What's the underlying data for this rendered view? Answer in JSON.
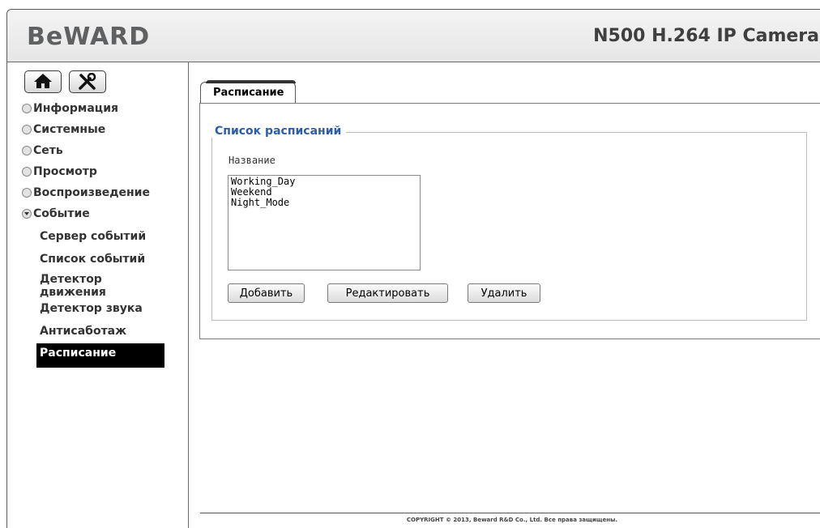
{
  "header": {
    "logo": "BeWARD",
    "product": "N500 H.264 IP Camera"
  },
  "toolbar": {
    "home_icon": "home-icon",
    "tools_icon": "tools-icon"
  },
  "sidebar": {
    "items": [
      {
        "label": "Информация",
        "expanded": false
      },
      {
        "label": "Системные",
        "expanded": false
      },
      {
        "label": "Сеть",
        "expanded": false
      },
      {
        "label": "Просмотр",
        "expanded": false
      },
      {
        "label": "Воспроизведение",
        "expanded": false
      },
      {
        "label": "Событие",
        "expanded": true
      }
    ],
    "subitems": [
      {
        "label": "Сервер событий"
      },
      {
        "label": "Список событий"
      },
      {
        "label": "Детектор движения"
      },
      {
        "label": "Детектор звука"
      },
      {
        "label": "Антисаботаж"
      },
      {
        "label": "Расписание",
        "active": true
      }
    ]
  },
  "main": {
    "tab": "Расписание",
    "fieldset_title": "Список расписаний",
    "column_header": "Название",
    "schedules": [
      "Working_Day",
      "Weekend",
      "Night_Mode"
    ],
    "buttons": {
      "add": "Добавить",
      "edit": "Редактировать",
      "delete": "Удалить"
    }
  },
  "footer": {
    "copyright": "COPYRIGHT © 2013, Beward R&D Co., Ltd. Все права защищены."
  },
  "colors": {
    "legend_blue": "#2b5ea6",
    "active_bg": "#000000"
  }
}
